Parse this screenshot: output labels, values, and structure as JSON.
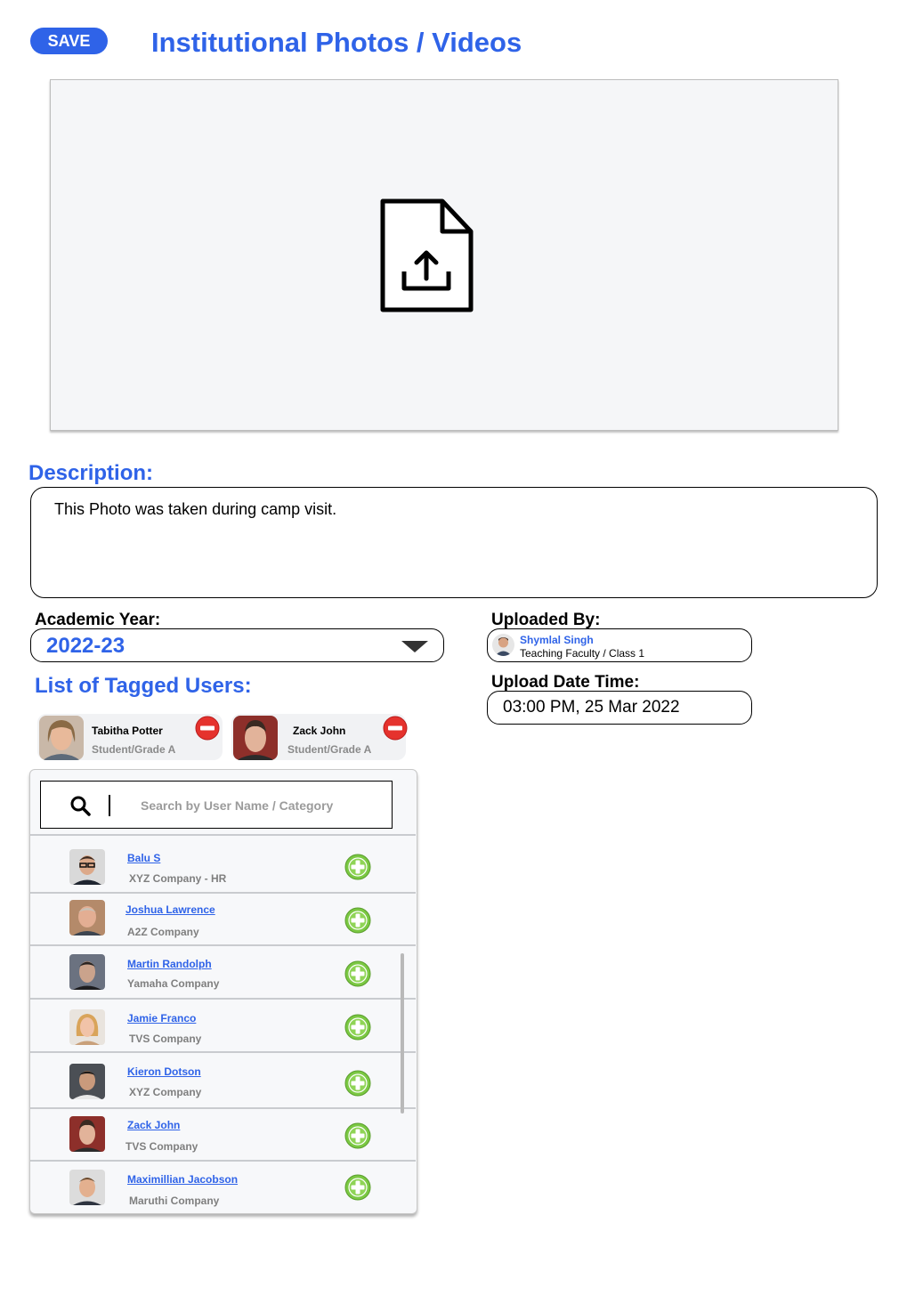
{
  "header": {
    "save_label": "SAVE",
    "title": "Institutional Photos / Videos"
  },
  "upload": {
    "icon": "file-upload-icon"
  },
  "description": {
    "label": "Description:",
    "text": "This Photo was taken during camp visit."
  },
  "academic_year": {
    "label": "Academic Year:",
    "value": "2022-23"
  },
  "uploaded_by": {
    "label": "Uploaded By:",
    "name": "Shymlal Singh",
    "role": "Teaching Faculty / Class 1"
  },
  "upload_datetime": {
    "label": "Upload Date Time:",
    "value": "03:00 PM, 25 Mar 2022"
  },
  "tagged": {
    "label": "List of Tagged Users:",
    "users": [
      {
        "name": "Tabitha Potter",
        "sub": "Student/Grade A"
      },
      {
        "name": "Zack John",
        "sub": "Student/Grade A"
      }
    ]
  },
  "search": {
    "placeholder": "Search by User Name / Category"
  },
  "users": [
    {
      "name": "Balu S",
      "company": "XYZ Company - HR"
    },
    {
      "name": "Joshua Lawrence",
      "company": "A2Z Company"
    },
    {
      "name": "Martin Randolph",
      "company": "Yamaha Company"
    },
    {
      "name": "Jamie Franco",
      "company": "TVS Company"
    },
    {
      "name": "Kieron Dotson",
      "company": "XYZ Company"
    },
    {
      "name": "Zack John",
      "company": "TVS Company"
    },
    {
      "name": "Maximillian Jacobson",
      "company": "Maruthi Company"
    }
  ],
  "colors": {
    "accent": "#2f63e8",
    "add_green": "#7bc843",
    "remove_red": "#e5322d"
  }
}
